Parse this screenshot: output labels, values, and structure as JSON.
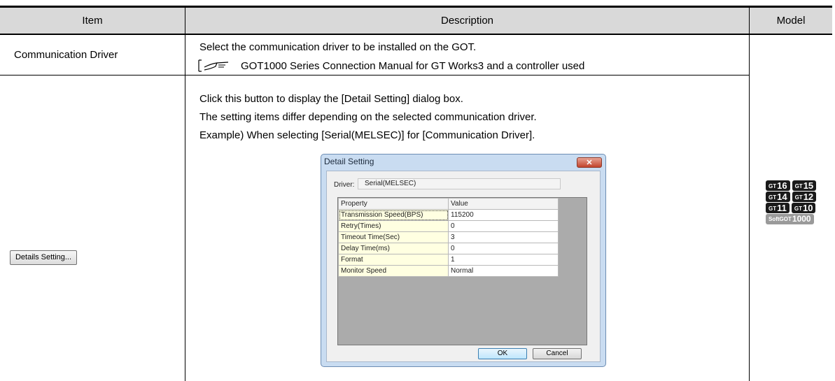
{
  "table": {
    "headers": {
      "item": "Item",
      "description": "Description",
      "model": "Model"
    },
    "row1": {
      "item": "Communication Driver",
      "desc_line": "Select the communication driver to be installed on the GOT.",
      "reference": "GOT1000 Series Connection Manual for GT Works3 and a controller used"
    },
    "row2": {
      "item_button": "Details Setting...",
      "desc_lines": [
        "Click this button to display the [Detail Setting] dialog box.",
        "The setting items differ depending on the selected communication driver.",
        "Example) When selecting [Serial(MELSEC)] for [Communication Driver]."
      ]
    },
    "models": {
      "prefix": "GT",
      "soft_prefix": "SoftGOT",
      "rows": [
        [
          "16",
          "15"
        ],
        [
          "14",
          "12"
        ],
        [
          "11",
          "10"
        ]
      ],
      "soft": "1000",
      "colors": {
        "badge": "#1a1a1a",
        "soft_badge": "#9a9a9a"
      }
    }
  },
  "dialog": {
    "title": "Detail Setting",
    "close_glyph": "✕",
    "driver_label": "Driver:",
    "driver_value": "Serial(MELSEC)",
    "columns": [
      "Property",
      "Value"
    ],
    "rows": [
      {
        "property": "Transmission Speed(BPS)",
        "value": "115200"
      },
      {
        "property": "Retry(Times)",
        "value": "0"
      },
      {
        "property": "Timeout Time(Sec)",
        "value": "3"
      },
      {
        "property": "Delay Time(ms)",
        "value": "0"
      },
      {
        "property": "Format",
        "value": "1"
      },
      {
        "property": "Monitor Speed",
        "value": "Normal"
      }
    ],
    "ok_label": "OK",
    "cancel_label": "Cancel"
  }
}
